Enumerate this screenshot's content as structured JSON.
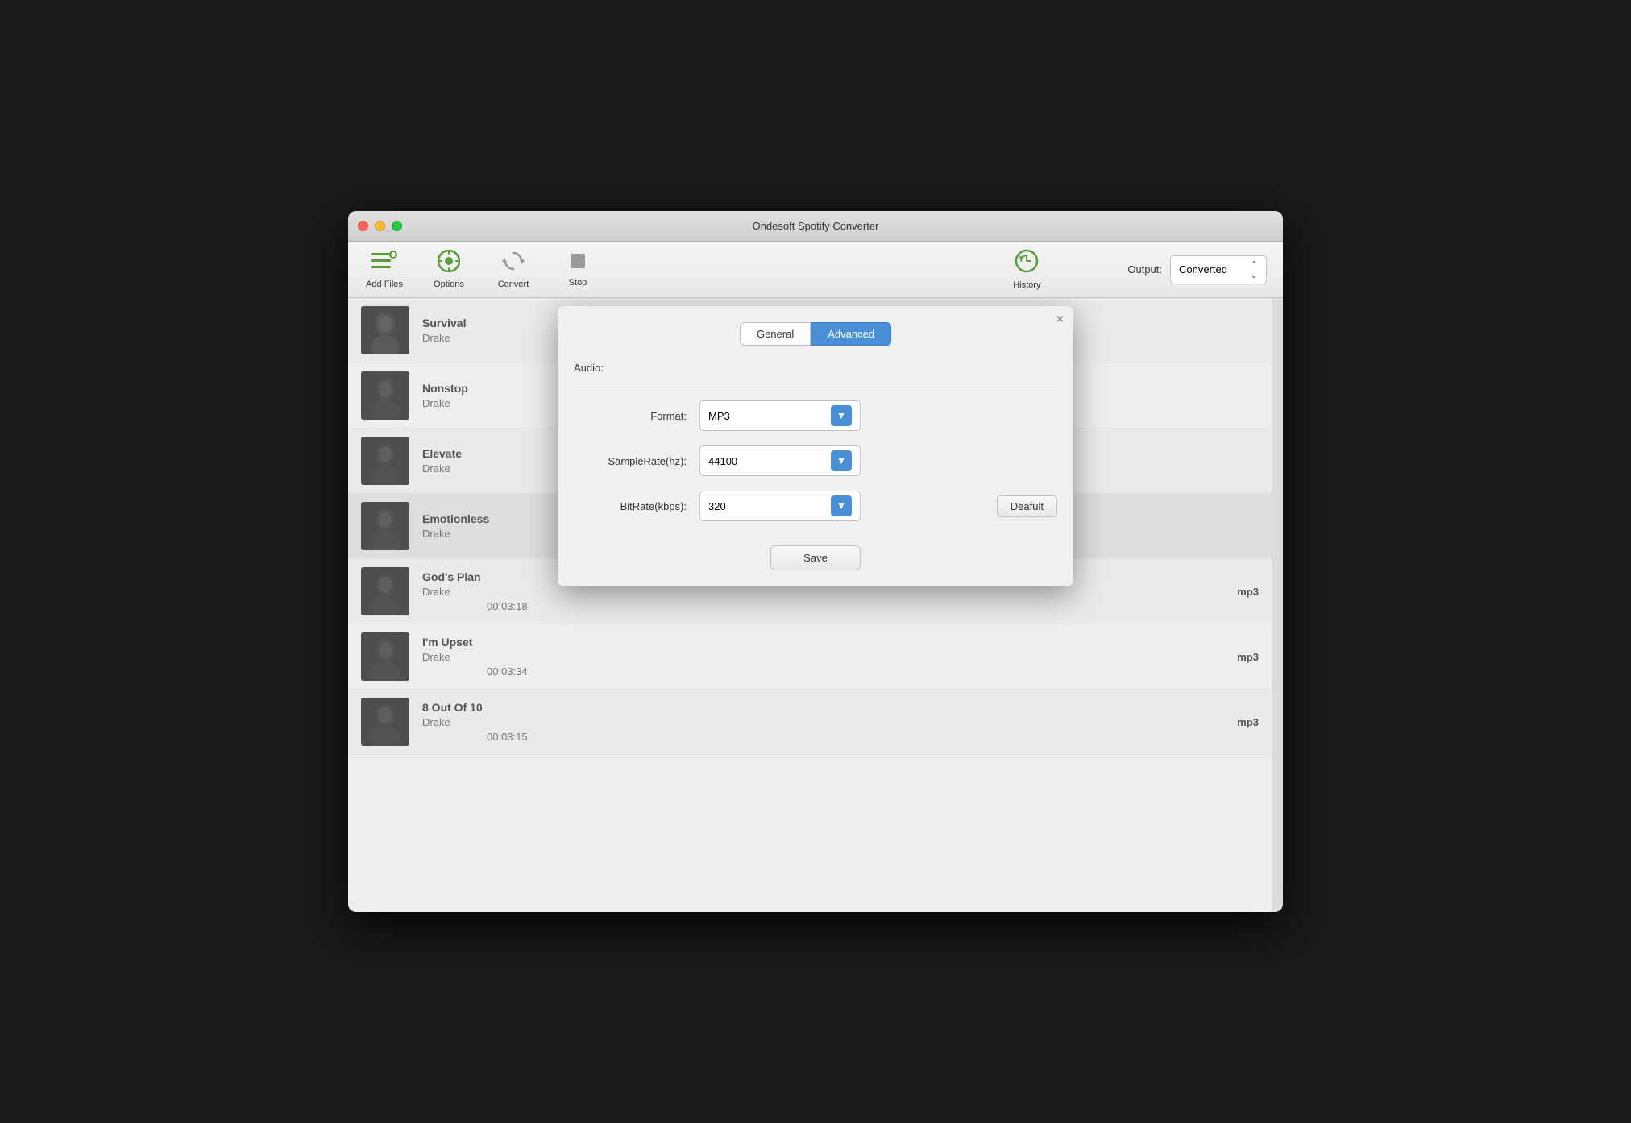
{
  "window": {
    "title": "Ondesoft Spotify Converter"
  },
  "toolbar": {
    "add_files_label": "Add Files",
    "options_label": "Options",
    "convert_label": "Convert",
    "stop_label": "Stop",
    "history_label": "History",
    "output_label": "Output:",
    "output_value": "Converted"
  },
  "tabs": {
    "general": "General",
    "advanced": "Advanced"
  },
  "modal": {
    "close_label": "×",
    "audio_label": "Audio:",
    "format_label": "Format:",
    "format_value": "MP3",
    "samplerate_label": "SampleRate(hz):",
    "samplerate_value": "44100",
    "bitrate_label": "BitRate(kbps):",
    "bitrate_value": "320",
    "default_btn": "Deafult",
    "save_btn": "Save"
  },
  "tracks": [
    {
      "title": "Survival",
      "artist": "Drake",
      "duration": "",
      "format": ""
    },
    {
      "title": "Nonstop",
      "artist": "Drake",
      "duration": "",
      "format": ""
    },
    {
      "title": "Elevate",
      "artist": "Drake",
      "duration": "",
      "format": ""
    },
    {
      "title": "Emotionless",
      "artist": "Drake",
      "duration": "",
      "format": ""
    },
    {
      "title": "God's Plan",
      "artist": "Drake",
      "duration": "00:03:18",
      "format": "mp3"
    },
    {
      "title": "I'm Upset",
      "artist": "Drake",
      "duration": "00:03:34",
      "format": "mp3"
    },
    {
      "title": "8 Out Of 10",
      "artist": "Drake",
      "duration": "00:03:15",
      "format": "mp3"
    }
  ]
}
